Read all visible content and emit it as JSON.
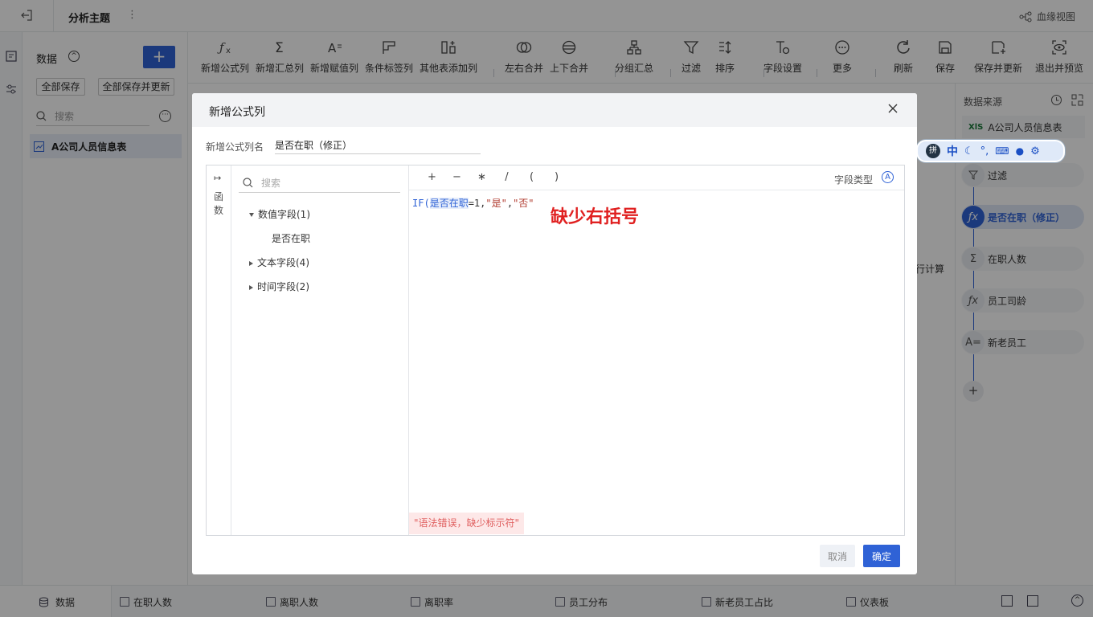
{
  "topbar": {
    "title": "分析主题",
    "lineage_label": "血缘视图"
  },
  "data_panel": {
    "title": "数据",
    "save_all": "全部保存",
    "save_all_update": "全部保存并更新",
    "search_placeholder": "搜索",
    "table_name": "A公司人员信息表"
  },
  "toolbar": {
    "items": [
      {
        "label": "新增公式列",
        "icon": "formula-icon"
      },
      {
        "label": "新增汇总列",
        "icon": "sigma-icon"
      },
      {
        "label": "新增赋值列",
        "icon": "assign-icon"
      },
      {
        "label": "条件标签列",
        "icon": "condition-tag-icon"
      },
      {
        "label": "其他表添加列",
        "icon": "other-table-icon"
      },
      {
        "label": "左右合并",
        "icon": "merge-horizontal-icon"
      },
      {
        "label": "上下合并",
        "icon": "merge-vertical-icon"
      },
      {
        "label": "分组汇总",
        "icon": "group-summary-icon"
      },
      {
        "label": "过滤",
        "icon": "filter-icon"
      },
      {
        "label": "排序",
        "icon": "sort-icon"
      },
      {
        "label": "字段设置",
        "icon": "field-settings-icon"
      },
      {
        "label": "更多",
        "icon": "more-icon"
      },
      {
        "label": "刷新",
        "icon": "refresh-icon"
      },
      {
        "label": "保存",
        "icon": "save-icon"
      },
      {
        "label": "保存并更新",
        "icon": "save-update-icon"
      },
      {
        "label": "退出并预览",
        "icon": "exit-preview-icon"
      }
    ]
  },
  "work_area": {
    "partial_text": "行计算"
  },
  "right_panel": {
    "title": "数据来源",
    "source": "A公司人员信息表",
    "source_badge": "XlS",
    "steps": [
      "过滤",
      "是否在职（修正）",
      "在职人数",
      "员工司龄",
      "新老员工"
    ],
    "add": "+"
  },
  "ime_toolbar": {
    "mode": "中"
  },
  "bottom_tabs": [
    "数据",
    "在职人数",
    "离职人数",
    "离职率",
    "员工分布",
    "新老员工占比",
    "仪表板"
  ],
  "dialog": {
    "title": "新增公式列",
    "name_label": "新增公式列名",
    "name_value": "是否在职（修正）",
    "functions_tab": "函数",
    "search_placeholder": "搜索",
    "tree": [
      {
        "label": "数值字段(1)",
        "expanded": true,
        "children": [
          "是否在职"
        ]
      },
      {
        "label": "文本字段(4)",
        "expanded": false
      },
      {
        "label": "时间字段(2)",
        "expanded": false
      }
    ],
    "operators": [
      "+",
      "−",
      "∗",
      "/",
      "(",
      ")"
    ],
    "field_type_label": "字段类型",
    "formula": {
      "fn": "IF(",
      "field": "是否在职",
      "rest_a": "=1,",
      "str1": "\"是\"",
      "comma": ",",
      "str2": "\"否\""
    },
    "annotation": "缺少右括号",
    "error": "\"语法错误，缺少标示符\"",
    "cancel": "取消",
    "confirm": "确定"
  },
  "colors": {
    "accent": "#2f62d6",
    "error_text": "#e02020",
    "error_bg": "#fde8e8",
    "overlay": "rgba(0,0,0,0.42)"
  }
}
